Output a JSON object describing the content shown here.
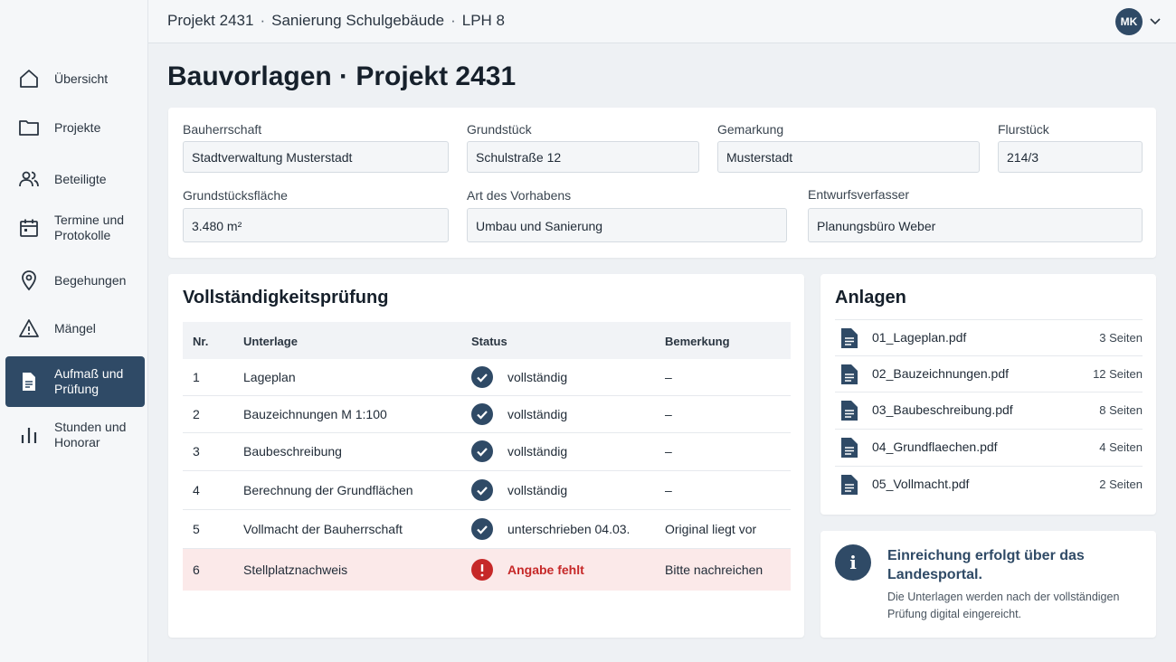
{
  "breadcrumb": [
    "Projekt 2431",
    "Sanierung Schulgebäude",
    "LPH 8"
  ],
  "breadcrumb_separator": "·",
  "user": {
    "initials": "MK"
  },
  "sidebar": {
    "items": [
      {
        "label": "Übersicht",
        "icon": "home-icon",
        "active": false
      },
      {
        "label": "Projekte",
        "icon": "folder-icon",
        "active": false
      },
      {
        "label": "Beteiligte",
        "icon": "users-icon",
        "active": false
      },
      {
        "label": "Termine und Protokolle",
        "icon": "calendar-icon",
        "active": false
      },
      {
        "label": "Begehungen",
        "icon": "map-pin-icon",
        "active": false
      },
      {
        "label": "Mängel",
        "icon": "warning-icon",
        "active": false
      },
      {
        "label": "Aufmaß und Prüfung",
        "icon": "document-icon",
        "active": true
      },
      {
        "label": "Stunden und Honorar",
        "icon": "bar-chart-icon",
        "active": false
      }
    ]
  },
  "page": {
    "title": "Bauvorlagen · Projekt 2431"
  },
  "form": {
    "bauherrschaft": {
      "label": "Bauherrschaft",
      "value": "Stadtverwaltung Musterstadt"
    },
    "grundstueck": {
      "label": "Grundstück",
      "value": "Schulstraße 12"
    },
    "gemarkung": {
      "label": "Gemarkung",
      "value": "Musterstadt"
    },
    "flurstueck": {
      "label": "Flurstück",
      "value": "214/3"
    },
    "flaeche": {
      "label": "Grundstücksfläche",
      "value": "3.480 m²"
    },
    "vorhaben": {
      "label": "Art des Vorhabens",
      "value": "Umbau und Sanierung"
    },
    "verfasser": {
      "label": "Entwurfsverfasser",
      "value": "Planungsbüro Weber"
    }
  },
  "check": {
    "title": "Vollständigkeitsprüfung",
    "columns": {
      "nr": "Nr.",
      "unterlage": "Unterlage",
      "status": "Status",
      "bemerkung": "Bemerkung"
    },
    "rows": [
      {
        "nr": "1",
        "unterlage": "Lageplan",
        "status": "vollständig",
        "bemerkung": "–",
        "ok": true
      },
      {
        "nr": "2",
        "unterlage": "Bauzeichnungen M 1:100",
        "status": "vollständig",
        "bemerkung": "–",
        "ok": true
      },
      {
        "nr": "3",
        "unterlage": "Baubeschreibung",
        "status": "vollständig",
        "bemerkung": "–",
        "ok": true
      },
      {
        "nr": "4",
        "unterlage": "Berechnung der Grundflächen",
        "status": "vollständig",
        "bemerkung": "–",
        "ok": true
      },
      {
        "nr": "5",
        "unterlage": "Vollmacht der Bauherrschaft",
        "status": "unterschrieben 04.03.",
        "bemerkung": "Original liegt vor",
        "ok": true
      },
      {
        "nr": "6",
        "unterlage": "Stellplatznachweis",
        "status": "Angabe fehlt",
        "bemerkung": "Bitte nachreichen",
        "ok": false
      }
    ]
  },
  "attachments": {
    "title": "Anlagen",
    "files": [
      {
        "name": "01_Lageplan.pdf",
        "pages": "3 Seiten"
      },
      {
        "name": "02_Bauzeichnungen.pdf",
        "pages": "12 Seiten"
      },
      {
        "name": "03_Baubeschreibung.pdf",
        "pages": "8 Seiten"
      },
      {
        "name": "04_Grundflaechen.pdf",
        "pages": "4 Seiten"
      },
      {
        "name": "05_Vollmacht.pdf",
        "pages": "2 Seiten"
      }
    ]
  },
  "info": {
    "icon_glyph": "i",
    "title": "Einreichung erfolgt über das Landesportal.",
    "text": "Die Unterlagen werden nach der vollständigen Prüfung digital eingereicht."
  },
  "colors": {
    "primary": "#2f4a66",
    "error": "#c62828",
    "error_bg": "#fbe9e9"
  }
}
